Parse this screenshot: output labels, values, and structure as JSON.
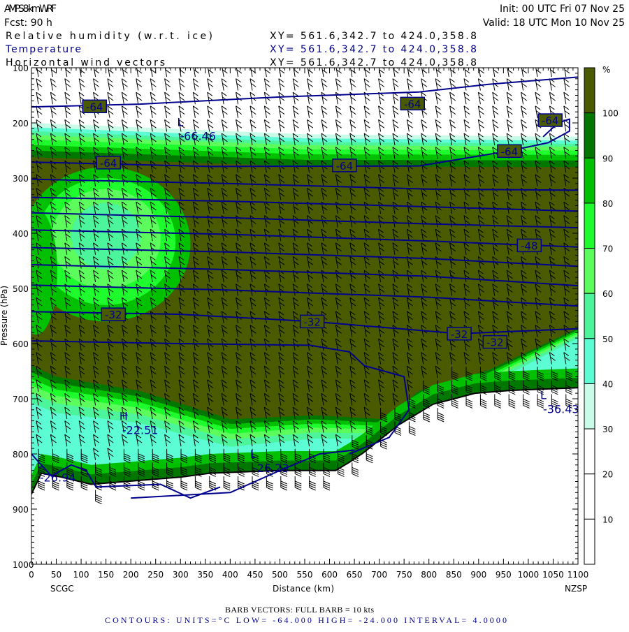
{
  "header": {
    "model": "AMPS 8-km WRF",
    "init": "Init: 00 UTC Fri 07 Nov 25",
    "fcst": "Fcst:   90 h",
    "valid": "Valid: 18 UTC Mon 10 Nov 25",
    "fields": [
      {
        "name": "Relative humidity (w.r.t. ice)",
        "xy": "XY= 561.6,342.7 to 424.0,358.8"
      },
      {
        "name": "Temperature",
        "xy": "XY= 561.6,342.7 to 424.0,358.8"
      },
      {
        "name": "Horizontal wind vectors",
        "xy": "XY= 561.6,342.7 to 424.0,358.8"
      }
    ]
  },
  "footer": {
    "barbs": "BARB VECTORS:  FULL BARB = 10 kts",
    "contours": "CONTOURS:  UNITS=°C  LOW= -64.000      HIGH= -24.000      INTERVAL=    4.0000"
  },
  "colors": {
    "contour": "#00008c",
    "text_blue": "#00008c"
  },
  "chart_data": {
    "type": "heatmap",
    "title": "Vertical cross-section",
    "xlabel": "Distance (km)",
    "ylabel": "Pressure (hPa)",
    "xlim": [
      0,
      1100
    ],
    "ylim": [
      1000,
      100
    ],
    "xticks": [
      "0",
      "50",
      "100",
      "150",
      "200",
      "250",
      "300",
      "350",
      "400",
      "450",
      "500",
      "550",
      "600",
      "650",
      "700",
      "750",
      "800",
      "850",
      "900",
      "950",
      "1000",
      "1050",
      "1100"
    ],
    "yticks": [
      "100",
      "200",
      "300",
      "400",
      "500",
      "600",
      "700",
      "800",
      "900",
      "1000"
    ],
    "endpoints": {
      "left": "SCGC",
      "right": "NZSP"
    },
    "colorbar": {
      "unit": "%",
      "labels": [
        "100",
        "90",
        "80",
        "70",
        "60",
        "50",
        "40",
        "30",
        "20",
        "10"
      ],
      "bins": [
        {
          "range": [
            100,
            110
          ],
          "color": "#4a5a00"
        },
        {
          "range": [
            90,
            100
          ],
          "color": "#007800"
        },
        {
          "range": [
            80,
            90
          ],
          "color": "#00c000"
        },
        {
          "range": [
            70,
            80
          ],
          "color": "#1efc2e"
        },
        {
          "range": [
            60,
            70
          ],
          "color": "#5cfc5c"
        },
        {
          "range": [
            50,
            60
          ],
          "color": "#4cf49c"
        },
        {
          "range": [
            40,
            50
          ],
          "color": "#5cfcd4"
        },
        {
          "range": [
            30,
            40
          ],
          "color": "#c8fce8"
        },
        {
          "range": [
            20,
            30
          ],
          "color": "#ffffff"
        },
        {
          "range": [
            10,
            20
          ],
          "color": "#ffffff"
        },
        {
          "range": [
            0,
            10
          ],
          "color": "#ffffff"
        }
      ]
    },
    "terrain": [
      [
        0,
        873
      ],
      [
        20,
        835
      ],
      [
        60,
        842
      ],
      [
        120,
        855
      ],
      [
        218,
        848
      ],
      [
        300,
        842
      ],
      [
        359,
        835
      ],
      [
        500,
        830
      ],
      [
        612,
        830
      ],
      [
        640,
        815
      ],
      [
        668,
        798
      ],
      [
        738,
        748
      ],
      [
        808,
        710
      ],
      [
        893,
        690
      ],
      [
        963,
        685
      ],
      [
        1100,
        680
      ]
    ],
    "rh_upper_band_tops": [
      [
        200,
        225
      ],
      [
        208,
        232
      ],
      [
        215,
        238
      ],
      [
        222,
        243
      ],
      [
        230,
        250
      ],
      [
        240,
        258
      ],
      [
        250,
        268
      ],
      [
        262,
        280
      ]
    ],
    "rh_olive_lower_boundary": [
      [
        0,
        640
      ],
      [
        50,
        660
      ],
      [
        218,
        686
      ],
      [
        401,
        737
      ],
      [
        570,
        730
      ],
      [
        710,
        737
      ],
      [
        780,
        686
      ],
      [
        920,
        648
      ],
      [
        1100,
        572
      ]
    ],
    "isotherms": [
      {
        "value": -64,
        "points": [
          [
            0,
            171
          ],
          [
            218,
            166
          ],
          [
            499,
            153
          ],
          [
            780,
            144
          ],
          [
            920,
            130
          ],
          [
            1100,
            117
          ]
        ]
      },
      {
        "value": -64,
        "points": [
          [
            0,
            271
          ],
          [
            360,
            279
          ],
          [
            780,
            278
          ],
          [
            960,
            251
          ],
          [
            1040,
            236
          ],
          [
            1083,
            215
          ],
          [
            1083,
            193
          ],
          [
            1060,
            200
          ],
          [
            1030,
            225
          ]
        ]
      },
      {
        "value": -60,
        "points": [
          [
            0,
            302
          ],
          [
            400,
            310
          ],
          [
            800,
            320
          ],
          [
            1100,
            322
          ]
        ]
      },
      {
        "value": -56,
        "points": [
          [
            0,
            335
          ],
          [
            400,
            342
          ],
          [
            800,
            352
          ],
          [
            1100,
            360
          ]
        ]
      },
      {
        "value": -52,
        "points": [
          [
            0,
            363
          ],
          [
            400,
            372
          ],
          [
            800,
            383
          ],
          [
            1100,
            390
          ]
        ]
      },
      {
        "value": -48,
        "points": [
          [
            0,
            394
          ],
          [
            400,
            402
          ],
          [
            800,
            414
          ],
          [
            1100,
            425
          ]
        ]
      },
      {
        "value": -44,
        "points": [
          [
            0,
            426
          ],
          [
            400,
            434
          ],
          [
            800,
            446
          ],
          [
            1100,
            460
          ]
        ]
      },
      {
        "value": -40,
        "points": [
          [
            0,
            457
          ],
          [
            400,
            466
          ],
          [
            800,
            478
          ],
          [
            1100,
            495
          ]
        ]
      },
      {
        "value": -36,
        "points": [
          [
            0,
            494
          ],
          [
            400,
            503
          ],
          [
            800,
            516
          ],
          [
            1100,
            532
          ]
        ]
      },
      {
        "value": -32,
        "points": [
          [
            0,
            542
          ],
          [
            300,
            547
          ],
          [
            565,
            560
          ],
          [
            861,
            582
          ],
          [
            1100,
            573
          ]
        ]
      },
      {
        "value": -28,
        "points": [
          [
            0,
            595
          ],
          [
            300,
            600
          ],
          [
            560,
            603
          ],
          [
            640,
            615
          ],
          [
            670,
            640
          ],
          [
            750,
            660
          ],
          [
            760,
            720
          ],
          [
            720,
            770
          ],
          [
            640,
            800
          ]
        ]
      },
      {
        "value": -24,
        "points": [
          [
            0,
            800
          ],
          [
            40,
            840
          ],
          [
            80,
            820
          ],
          [
            110,
            830
          ],
          [
            130,
            860
          ],
          [
            260,
            855
          ],
          [
            320,
            880
          ],
          [
            380,
            860
          ]
        ]
      },
      {
        "value": -24,
        "points": [
          [
            200,
            880
          ],
          [
            400,
            870
          ],
          [
            500,
            830
          ],
          [
            580,
            800
          ],
          [
            650,
            793
          ]
        ]
      }
    ],
    "contour_labels": [
      {
        "text": "-64",
        "km": 127,
        "hPa": 170
      },
      {
        "text": "-64",
        "km": 767,
        "hPa": 165
      },
      {
        "text": "-64",
        "km": 1044,
        "hPa": 195
      },
      {
        "text": "-64",
        "km": 962,
        "hPa": 251
      },
      {
        "text": "-64",
        "km": 155,
        "hPa": 272
      },
      {
        "text": "-64",
        "km": 630,
        "hPa": 277
      },
      {
        "text": "-48",
        "km": 1002,
        "hPa": 422
      },
      {
        "text": "-32",
        "km": 165,
        "hPa": 547
      },
      {
        "text": "-32",
        "km": 565,
        "hPa": 560
      },
      {
        "text": "-32",
        "km": 861,
        "hPa": 582
      },
      {
        "text": "-32",
        "km": 933,
        "hPa": 597
      }
    ],
    "extrema": [
      {
        "type": "L",
        "value": "-66.46",
        "km": 324,
        "hPa": 213
      },
      {
        "type": "H",
        "value": "-22.51",
        "km": 208,
        "hPa": 746
      },
      {
        "type": "L",
        "value": "-26.94",
        "km": 42,
        "hPa": 832
      },
      {
        "type": "L",
        "value": "-26.23",
        "km": 471,
        "hPa": 815
      },
      {
        "type": "L",
        "value": "-36.43",
        "km": 1055,
        "hPa": 708
      }
    ]
  }
}
